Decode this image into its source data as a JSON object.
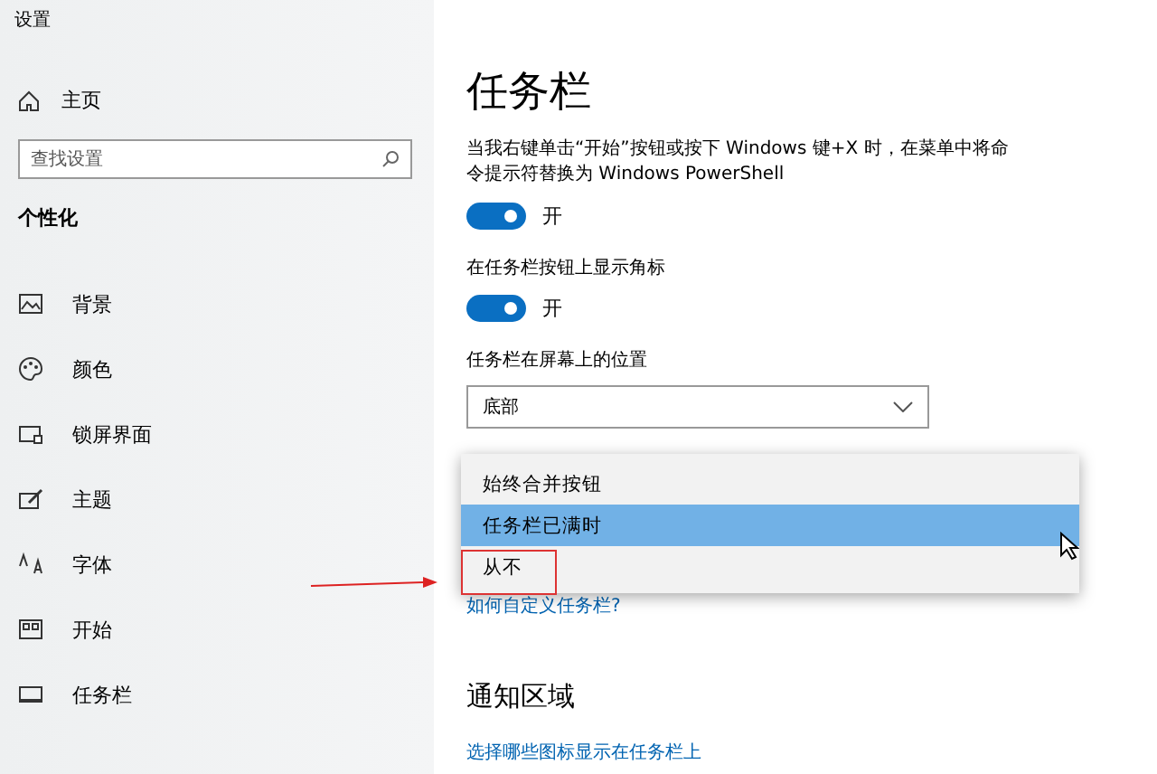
{
  "window": {
    "title": "设置"
  },
  "sidebar": {
    "home": {
      "label": "主页"
    },
    "search": {
      "placeholder": "查找设置"
    },
    "section": "个性化",
    "items": [
      {
        "label": "背景",
        "selected": false
      },
      {
        "label": "颜色",
        "selected": false
      },
      {
        "label": "锁屏界面",
        "selected": false
      },
      {
        "label": "主题",
        "selected": false
      },
      {
        "label": "字体",
        "selected": false
      },
      {
        "label": "开始",
        "selected": false
      },
      {
        "label": "任务栏",
        "selected": false
      }
    ]
  },
  "page": {
    "title": "任务栏",
    "settings": [
      {
        "label": "当我右键单击“开始”按钮或按下 Windows 键+X 时，在菜单中将命令提示符替换为 Windows PowerShell",
        "on": true,
        "state_label": "开"
      },
      {
        "label": "在任务栏按钮上显示角标",
        "on": true,
        "state_label": "开"
      }
    ],
    "position": {
      "label": "任务栏在屏幕上的位置",
      "value": "底部"
    },
    "combine_menu": {
      "options": [
        {
          "label": "始终合并按钮",
          "hovered": false
        },
        {
          "label": "任务栏已满时",
          "hovered": true
        },
        {
          "label": "从不",
          "hovered": false
        }
      ]
    },
    "help_link": "如何自定义任务栏?",
    "notification": {
      "heading": "通知区域",
      "link": "选择哪些图标显示在任务栏上"
    }
  }
}
